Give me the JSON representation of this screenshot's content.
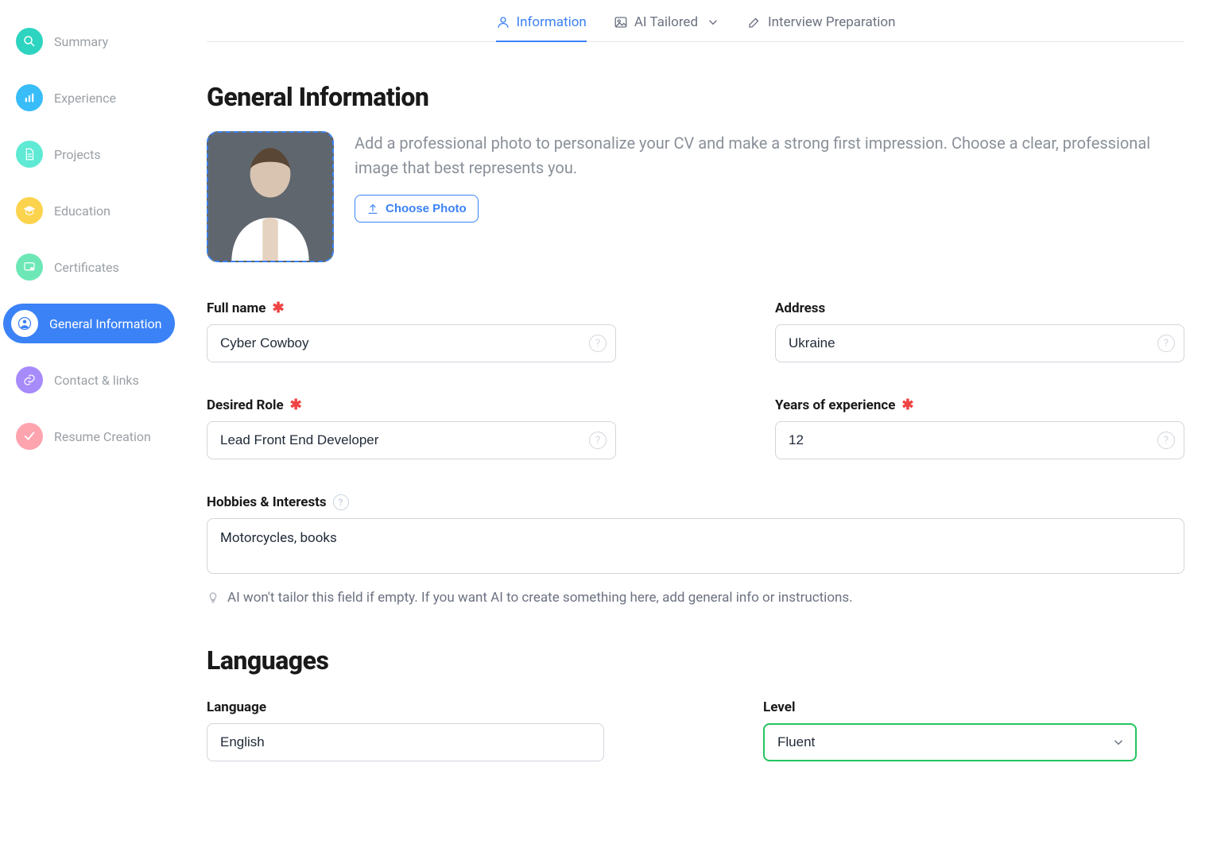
{
  "sidebar": {
    "items": [
      {
        "label": "Summary"
      },
      {
        "label": "Experience"
      },
      {
        "label": "Projects"
      },
      {
        "label": "Education"
      },
      {
        "label": "Certificates"
      },
      {
        "label": "General Information"
      },
      {
        "label": "Contact & links"
      },
      {
        "label": "Resume Creation"
      }
    ]
  },
  "tabs": {
    "information": "Information",
    "ai_tailored": "AI Tailored",
    "interview": "Interview Preparation"
  },
  "section_general_title": "General Information",
  "photo": {
    "description": "Add a professional photo to personalize your CV and make a strong first impression. Choose a clear, professional image that best represents you.",
    "choose_label": "Choose Photo"
  },
  "fields": {
    "full_name": {
      "label": "Full name",
      "value": "Cyber Cowboy"
    },
    "address": {
      "label": "Address",
      "value": "Ukraine"
    },
    "desired_role": {
      "label": "Desired Role",
      "value": "Lead Front End Developer"
    },
    "years_experience": {
      "label": "Years of experience",
      "value": "12"
    },
    "hobbies": {
      "label": "Hobbies & Interests",
      "value": "Motorcycles, books"
    }
  },
  "hobbies_hint": "AI won't tailor this field if empty. If you want AI to create something here, add general info or instructions.",
  "section_languages_title": "Languages",
  "languages": {
    "language_label": "Language",
    "level_label": "Level",
    "language_value": "English",
    "level_value": "Fluent"
  }
}
